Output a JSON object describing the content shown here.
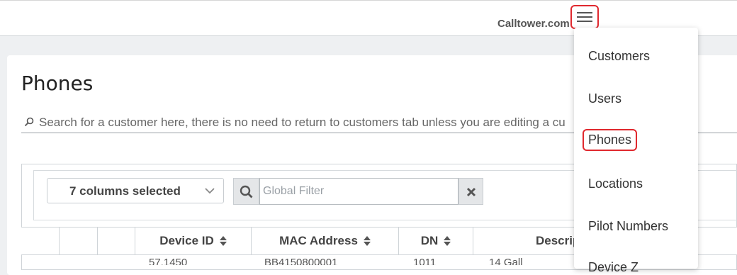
{
  "header": {
    "brand": "Calltower.com"
  },
  "page": {
    "title": "Phones",
    "search_placeholder": "Search for a customer here, there is no need to return to customers tab unless you are editing a cu"
  },
  "toolbar": {
    "columns_selected": "7 columns selected",
    "global_filter_placeholder": "Global Filter"
  },
  "table": {
    "columns": [
      "",
      "",
      "",
      "Device ID",
      "MAC Address",
      "DN",
      "Descrip"
    ],
    "peek_row": [
      "",
      "",
      "",
      "57.1450",
      "BB4150800001",
      "1011",
      "14 Gall"
    ]
  },
  "menu": {
    "items": [
      {
        "label": "Customers",
        "active": false
      },
      {
        "label": "Users",
        "active": false
      },
      {
        "label": "Phones",
        "active": true
      },
      {
        "label": "Locations",
        "active": false
      },
      {
        "label": "Pilot Numbers",
        "active": false
      },
      {
        "label": "Device Z",
        "active": false
      }
    ]
  },
  "colors": {
    "accent_red": "#e0282e"
  }
}
